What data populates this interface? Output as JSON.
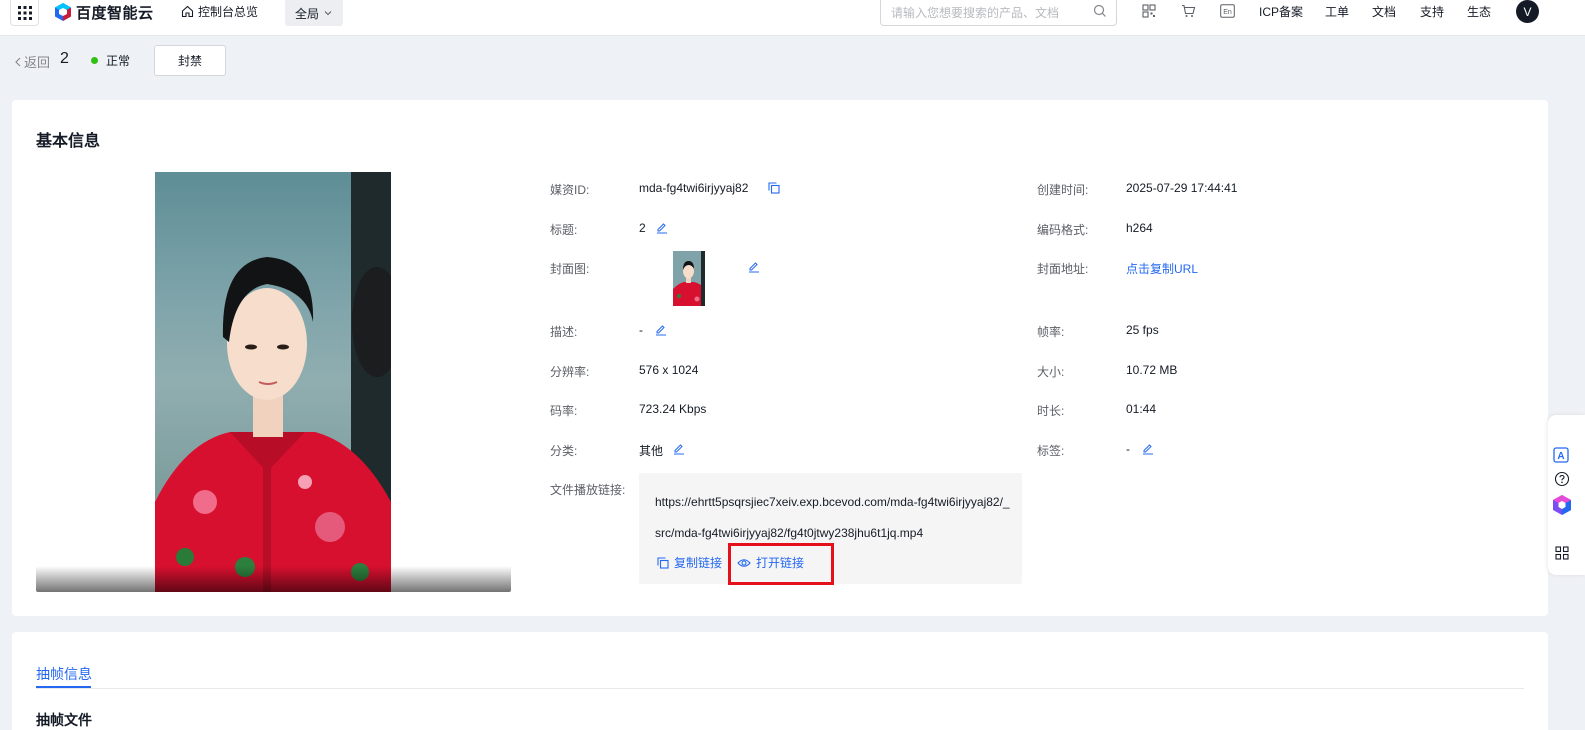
{
  "topbar": {
    "logo_text": "百度智能云",
    "console_home": "控制台总览",
    "scope": "全局",
    "search_placeholder": "请输入您想要搜索的产品、文档",
    "links": [
      "ICP备案",
      "工单",
      "文档",
      "支持",
      "生态"
    ],
    "avatar": "V",
    "lang_icon_text": "En"
  },
  "header": {
    "back_label": "返回",
    "title": "2",
    "status": "正常",
    "ban_button": "封禁"
  },
  "basic_info": {
    "section_title": "基本信息",
    "media_id_label": "媒资ID:",
    "media_id": "mda-fg4twi6irjyyaj82",
    "title_label": "标题:",
    "title_value": "2",
    "cover_label": "封面图:",
    "desc_label": "描述:",
    "desc_value": "-",
    "resolution_label": "分辨率:",
    "resolution": "576 x 1024",
    "bitrate_label": "码率:",
    "bitrate": "723.24 Kbps",
    "category_label": "分类:",
    "category": "其他",
    "play_url_label": "文件播放链接:",
    "play_url": "https://ehrtt5psqrsjiec7xeiv.exp.bcevod.com/mda-fg4twi6irjyyaj82/_src/mda-fg4twi6irjyyaj82/fg4t0jtwy238jhu6t1jq.mp4",
    "copy_link": "复制链接",
    "open_link": "打开链接",
    "created_label": "创建时间:",
    "created": "2025-07-29 17:44:41",
    "codec_label": "编码格式:",
    "codec": "h264",
    "cover_url_label": "封面地址:",
    "cover_url_link": "点击复制URL",
    "fps_label": "帧率:",
    "fps": "25 fps",
    "size_label": "大小:",
    "size": "10.72 MB",
    "duration_label": "时长:",
    "duration": "01:44",
    "tags_label": "标签:",
    "tags": "-"
  },
  "frames": {
    "tab": "抽帧信息",
    "sub_title": "抽帧文件"
  },
  "colors": {
    "primary": "#2468f2",
    "status_ok": "#30bf13",
    "highlight": "#e5101a"
  }
}
